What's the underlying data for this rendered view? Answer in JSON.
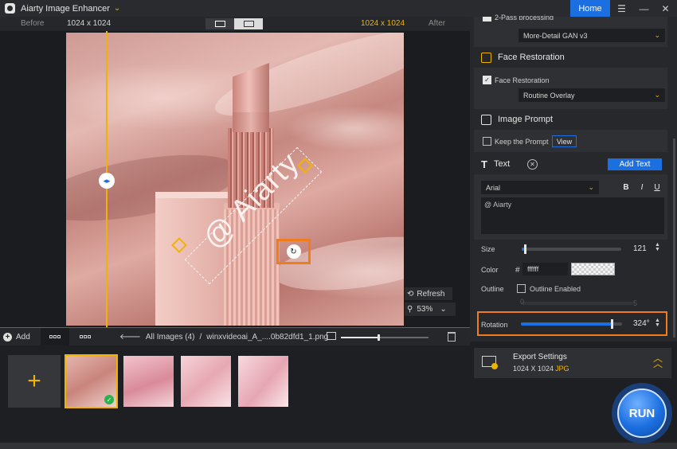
{
  "app": {
    "title": "Aiarty Image Enhancer",
    "home_label": "Home"
  },
  "window_controls": {
    "menu": "☰",
    "minimize": "—",
    "maximize": "☐",
    "close": "✕"
  },
  "compare": {
    "before_label": "Before",
    "after_label": "After",
    "before_resolution": "1024 x 1024",
    "after_resolution": "1024 x 1024",
    "view_modes": [
      "single-view",
      "split-view"
    ],
    "active_view": "split-view"
  },
  "watermark": {
    "text": "@ Aiarty"
  },
  "canvas_controls": {
    "refresh_label": "Refresh",
    "zoom_value": "53%"
  },
  "toolbar": {
    "add_label": "Add",
    "breadcrumb_parent": "All Images (4)",
    "breadcrumb_sep": "/",
    "file_name": "winxvideoai_A_....0b82dfd1_1.png",
    "preview_size_fraction": 0.43
  },
  "thumbnails": [
    {
      "name": "lipstick-1",
      "selected": true,
      "checked": true
    },
    {
      "name": "lipstick-2",
      "selected": false,
      "checked": false
    },
    {
      "name": "lipstick-3",
      "selected": false,
      "checked": false
    },
    {
      "name": "lipstick-4",
      "selected": false,
      "checked": false
    }
  ],
  "panel": {
    "top_partial_label": "2-Pass processing",
    "model_select": "More-Detail GAN  v3",
    "face_restoration": {
      "title": "Face Restoration",
      "checkbox_label": "Face Restoration",
      "checked": true,
      "mode": "Routine Overlay"
    },
    "image_prompt": {
      "title": "Image Prompt",
      "keep_label": "Keep the Prompt",
      "keep_checked": false,
      "view_label": "View"
    },
    "text": {
      "title": "Text",
      "add_label": "Add Text",
      "font": "Arial",
      "bold": "B",
      "italic": "I",
      "underline": "U",
      "content": "@ Aiarty",
      "size_label": "Size",
      "size_value": "121",
      "size_fraction": 0.03,
      "color_label": "Color",
      "hash": "#",
      "color_hex": "ffffff",
      "outline_label": "Outline",
      "outline_checkbox_label": "Outline Enabled",
      "outline_enabled": false,
      "outline_min": "0",
      "outline_max": "5",
      "rotation_label": "Rotation",
      "rotation_value": "324°",
      "rotation_fraction": 0.9
    },
    "export": {
      "title": "Export Settings",
      "size": "1024 X 1024",
      "format": "JPG"
    },
    "run_label": "RUN"
  },
  "colors": {
    "accent_blue": "#1c6fe0",
    "accent_gold": "#f0b400",
    "highlight_orange": "#f07d1a",
    "bg_dark": "#1e1f22"
  }
}
